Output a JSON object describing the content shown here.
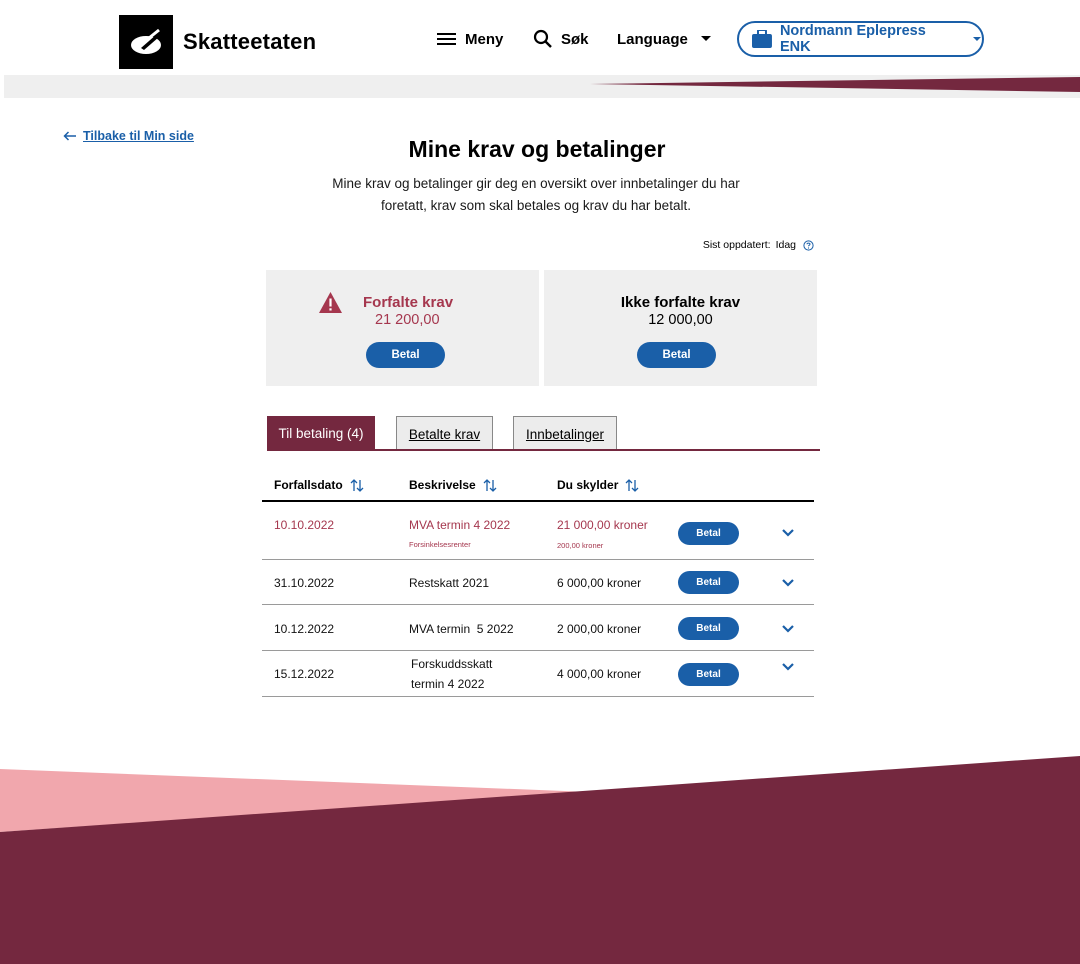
{
  "header": {
    "brand": "Skatteetaten",
    "menu_label": "Meny",
    "search_label": "Søk",
    "language_label": "Language",
    "org_name": "Nordmann Eplepress ENK"
  },
  "colors": {
    "primary": "#1a5fa8",
    "brand_dark": "#74283f",
    "alert": "#a5374e",
    "footer_light": "#f1a7ad"
  },
  "back_link": "Tilbake til Min side",
  "page": {
    "title": "Mine krav og betalinger",
    "intro": "Mine krav og betalinger gir deg en oversikt over innbetalinger du har foretatt, krav som skal betales og krav du har betalt.",
    "updated_label": "Sist oppdatert:",
    "updated_value": "Idag"
  },
  "summary": {
    "overdue": {
      "title": "Forfalte krav",
      "amount": "21 200,00",
      "button": "Betal"
    },
    "not_due": {
      "title": "Ikke forfalte krav",
      "amount": "12 000,00",
      "button": "Betal"
    }
  },
  "tabs": [
    {
      "label": "Til betaling (4)"
    },
    {
      "label": "Betalte krav"
    },
    {
      "label": "Innbetalinger"
    }
  ],
  "table": {
    "headers": [
      "Forfallsdato",
      "Beskrivelse",
      "Du skylder"
    ],
    "rows": [
      {
        "date": "10.10.2022",
        "desc": "MVA termin 4 2022",
        "desc_sub": "Forsinkelsesrenter",
        "amount": "21 000,00 kroner",
        "amount_sub": "200,00 kroner",
        "button": "Betal",
        "overdue": true
      },
      {
        "date": "31.10.2022",
        "desc": "Restskatt 2021",
        "amount": "6 000,00 kroner",
        "button": "Betal"
      },
      {
        "date": "10.12.2022",
        "desc": "MVA termin  5 2022",
        "amount": "2 000,00 kroner",
        "button": "Betal"
      },
      {
        "date": "15.12.2022",
        "desc_line1": "Forskuddsskatt",
        "desc_line2": "termin 4 2022",
        "amount": "4 000,00 kroner",
        "button": "Betal"
      }
    ]
  }
}
